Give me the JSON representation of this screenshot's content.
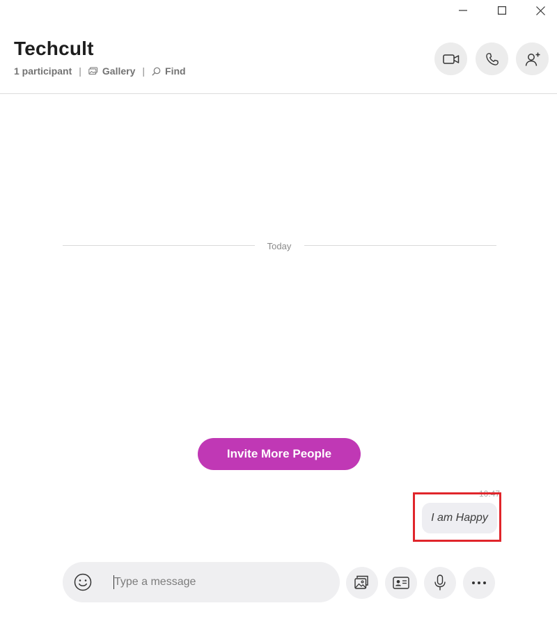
{
  "window": {
    "controls": [
      {
        "name": "minimize-button",
        "icon": "minimize-icon"
      },
      {
        "name": "maximize-button",
        "icon": "maximize-icon"
      },
      {
        "name": "close-button",
        "icon": "close-icon"
      }
    ]
  },
  "header": {
    "title": "Techcult",
    "participants": "1 participant",
    "separator": "|",
    "gallery_label": "Gallery",
    "find_label": "Find",
    "gallery_icon": "gallery-icon",
    "find_icon": "search-icon",
    "actions": [
      {
        "name": "video-call-button",
        "icon": "video-camera-icon"
      },
      {
        "name": "audio-call-button",
        "icon": "phone-icon"
      },
      {
        "name": "add-people-button",
        "icon": "add-person-icon"
      }
    ]
  },
  "conversation": {
    "day_divider": "Today",
    "invite_label": "Invite More People",
    "messages": [
      {
        "time": "10:47",
        "text": "I am Happy",
        "highlighted": true
      }
    ]
  },
  "composer": {
    "placeholder": "Type a message",
    "emoji_icon": "emoji-icon",
    "tools": [
      {
        "name": "share-media-button",
        "icon": "image-gallery-icon"
      },
      {
        "name": "send-contact-button",
        "icon": "contact-card-icon"
      },
      {
        "name": "voice-message-button",
        "icon": "microphone-icon"
      },
      {
        "name": "more-options-button",
        "icon": "more-dots-icon"
      }
    ]
  },
  "colors": {
    "accent": "#c038b5",
    "highlight": "#e0252b",
    "bubble": "#eeeef2",
    "button_bg": "#ececec"
  }
}
